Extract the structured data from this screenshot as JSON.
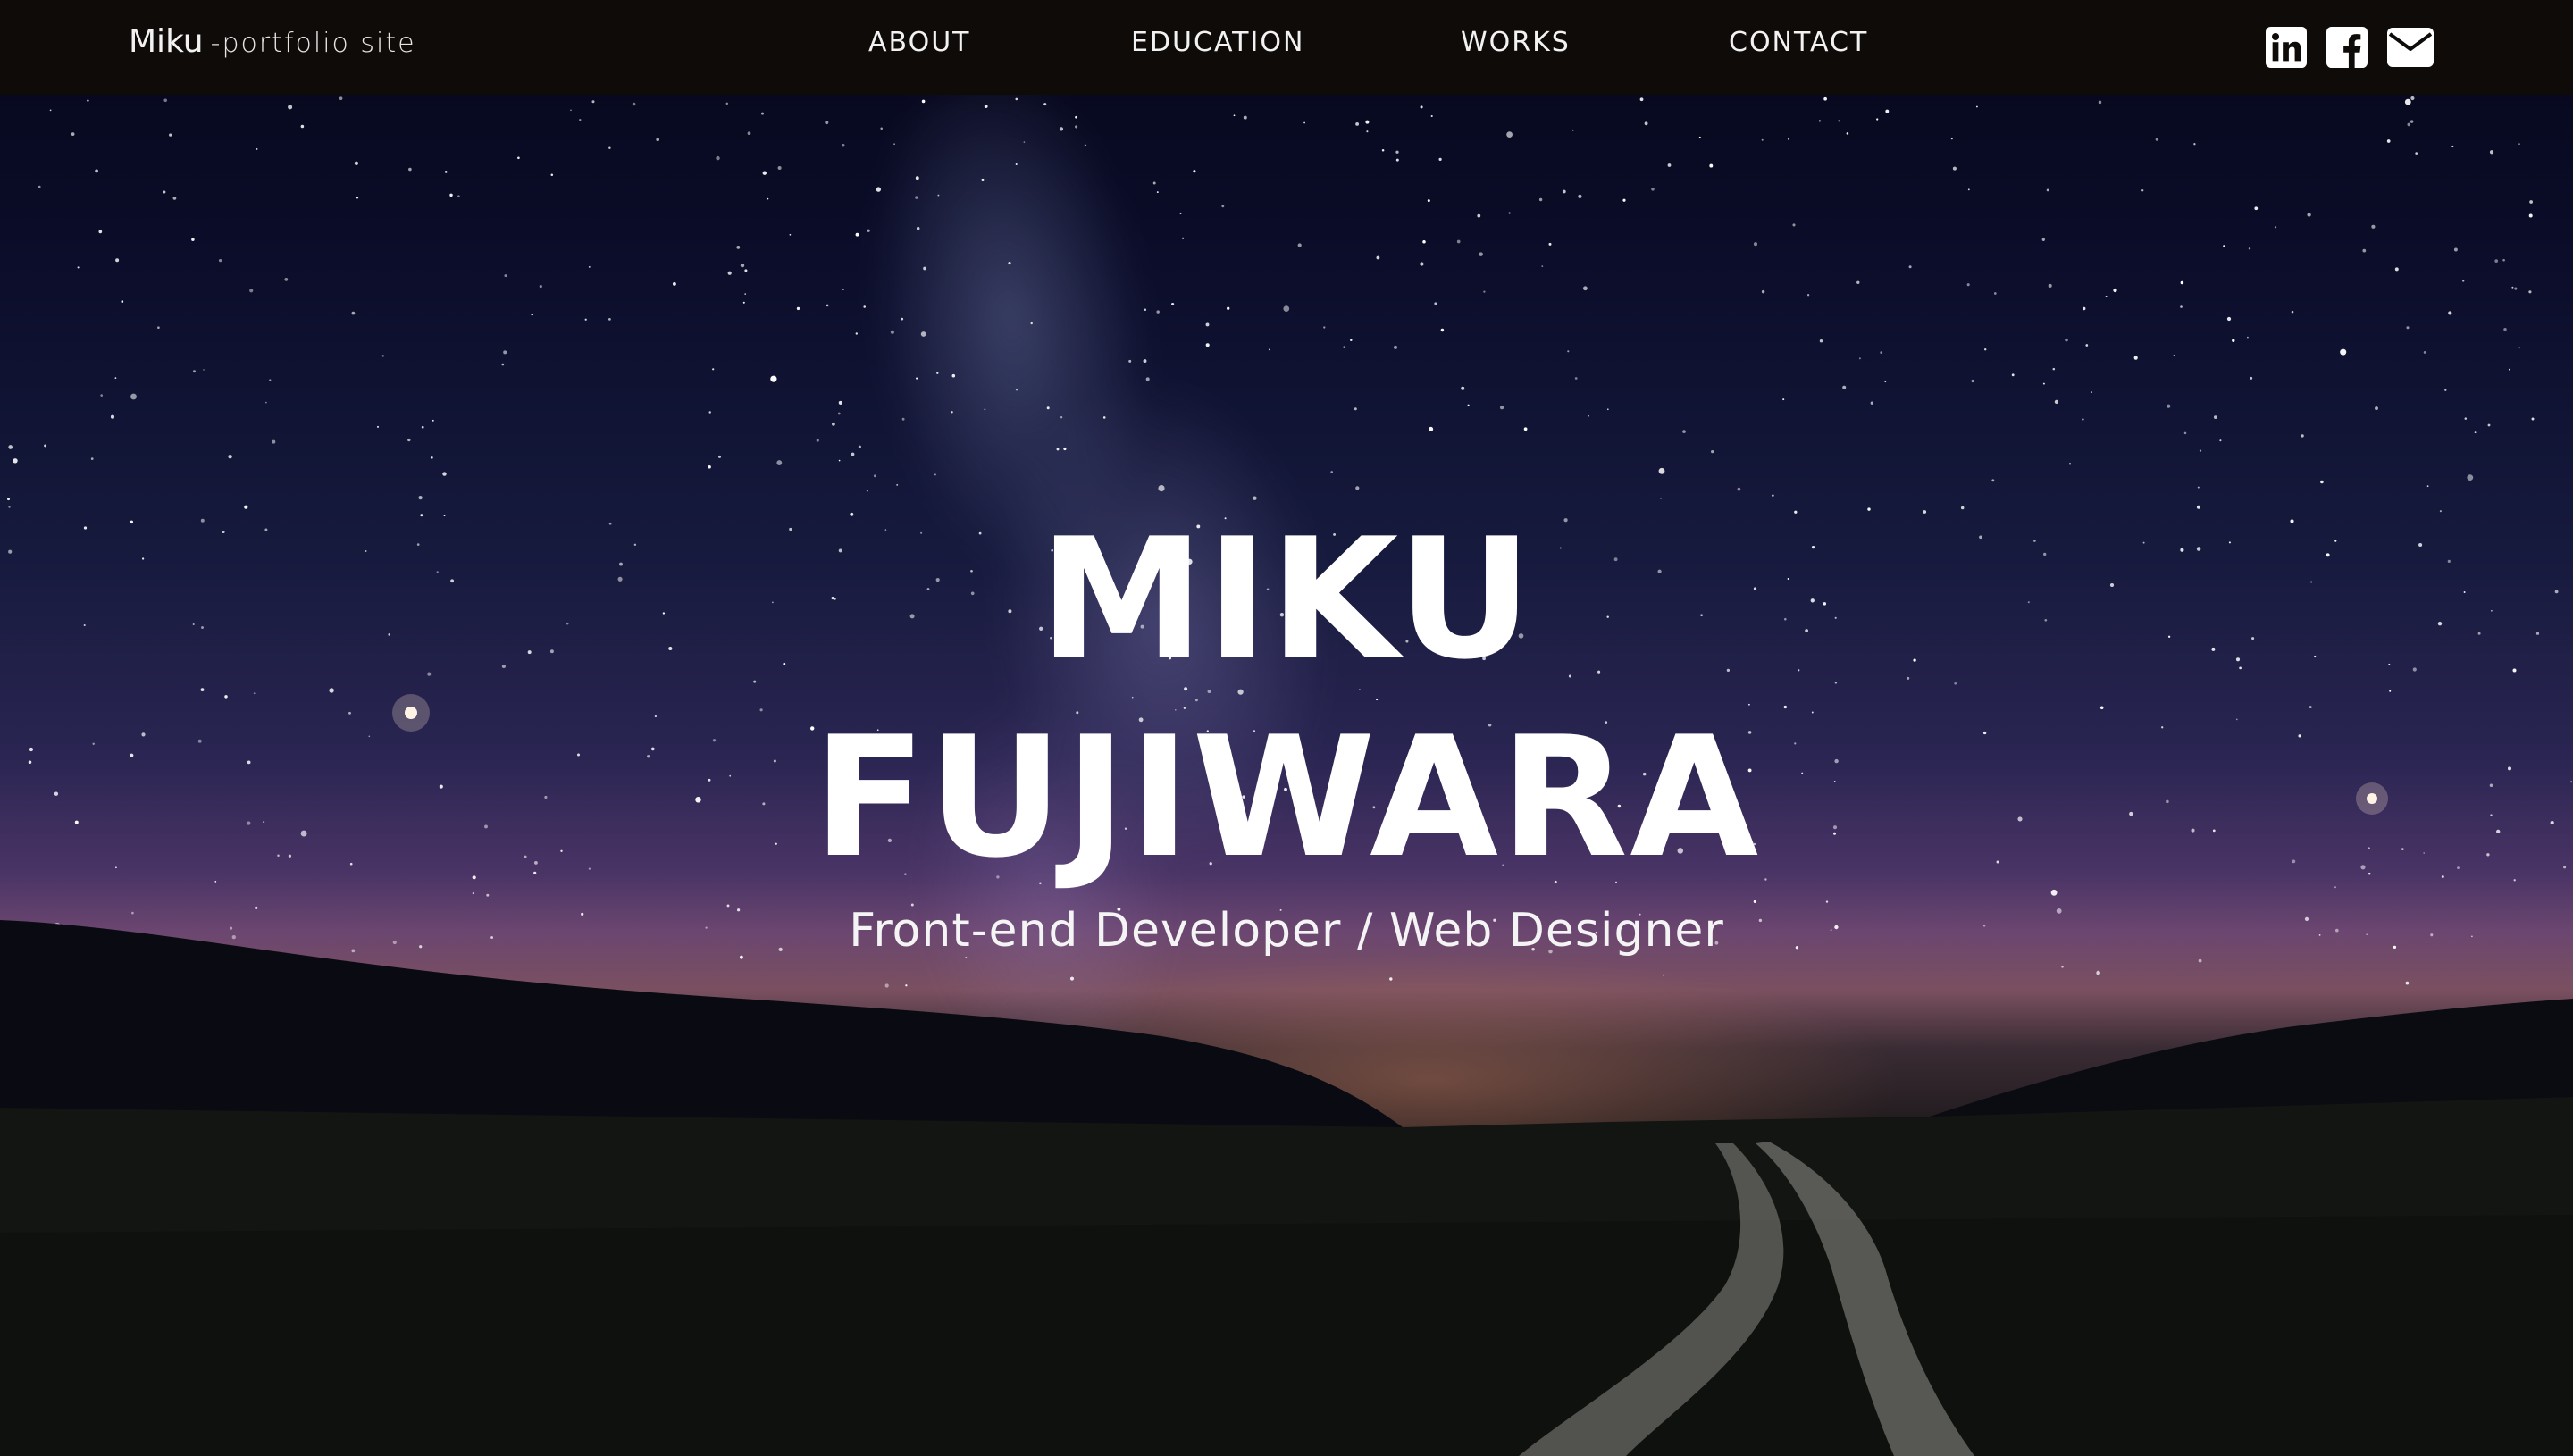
{
  "brand": {
    "name": "Miku",
    "tagline": "-portfolio site"
  },
  "nav": {
    "items": [
      {
        "label": "ABOUT"
      },
      {
        "label": "EDUCATION"
      },
      {
        "label": "WORKS"
      },
      {
        "label": "CONTACT"
      }
    ]
  },
  "social": {
    "icons": [
      "linkedin-icon",
      "facebook-icon",
      "mail-icon"
    ]
  },
  "hero": {
    "name_line1": "MIKU",
    "name_line2": "FUJIWARA",
    "subtitle": "Front-end Developer / Web Designer"
  },
  "colors": {
    "navbar_bg": "#0f0b09",
    "text": "#ffffff",
    "sky_top": "#06071a",
    "sky_horizon": "#6b4670"
  }
}
